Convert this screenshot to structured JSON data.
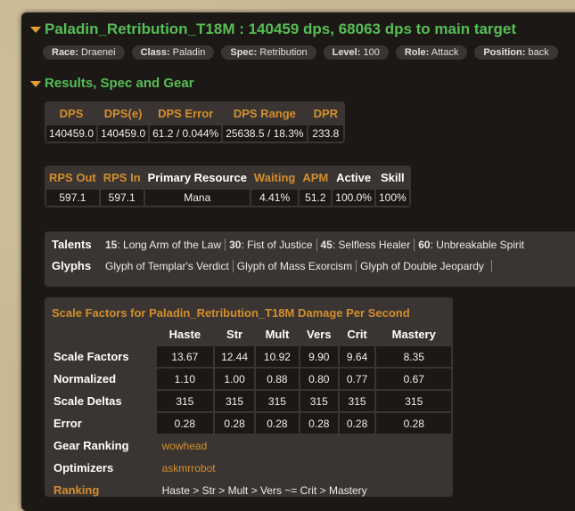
{
  "header": {
    "title": "Paladin_Retribution_T18M : 140459 dps, 68063 dps to main target",
    "tags": [
      {
        "key": "Race:",
        "value": "Draenei"
      },
      {
        "key": "Class:",
        "value": "Paladin"
      },
      {
        "key": "Spec:",
        "value": "Retribution"
      },
      {
        "key": "Level:",
        "value": "100"
      },
      {
        "key": "Role:",
        "value": "Attack"
      },
      {
        "key": "Position:",
        "value": "back"
      }
    ]
  },
  "section": {
    "title": "Results, Spec and Gear"
  },
  "dps_table": {
    "headers": [
      "DPS",
      "DPS(e)",
      "DPS Error",
      "DPS Range",
      "DPR"
    ],
    "values": [
      "140459.0",
      "140459.0",
      "61.2 / 0.044%",
      "25638.5 / 18.3%",
      "233.8"
    ]
  },
  "resource_table": {
    "headers": [
      "RPS Out",
      "RPS In",
      "Primary Resource",
      "Waiting",
      "APM",
      "Active",
      "Skill"
    ],
    "values": [
      "597.1",
      "597.1",
      "Mana",
      "4.41%",
      "51.2",
      "100.0%",
      "100%"
    ]
  },
  "talents": {
    "label": "Talents",
    "items": [
      {
        "tier": "15",
        "name": ": Long Arm of the Law"
      },
      {
        "tier": "30",
        "name": ": Fist of Justice"
      },
      {
        "tier": "45",
        "name": ": Selfless Healer"
      },
      {
        "tier": "60",
        "name": ": Unbreakable Spirit"
      }
    ]
  },
  "glyphs": {
    "label": "Glyphs",
    "items": [
      "Glyph of Templar's Verdict",
      "Glyph of Mass Exorcism",
      "Glyph of Double Jeopardy"
    ]
  },
  "scale_factors": {
    "title": "Scale Factors for Paladin_Retribution_T18M Damage Per Second",
    "columns": [
      "Haste",
      "Str",
      "Mult",
      "Vers",
      "Crit",
      "Mastery"
    ],
    "rows": [
      {
        "label": "Scale Factors",
        "values": [
          "13.67",
          "12.44",
          "10.92",
          "9.90",
          "9.64",
          "8.35"
        ]
      },
      {
        "label": "Normalized",
        "values": [
          "1.10",
          "1.00",
          "0.88",
          "0.80",
          "0.77",
          "0.67"
        ]
      },
      {
        "label": "Scale Deltas",
        "values": [
          "315",
          "315",
          "315",
          "315",
          "315",
          "315"
        ]
      },
      {
        "label": "Error",
        "values": [
          "0.28",
          "0.28",
          "0.28",
          "0.28",
          "0.28",
          "0.28"
        ]
      }
    ],
    "gear_ranking": {
      "label": "Gear Ranking",
      "link": "wowhead"
    },
    "optimizers": {
      "label": "Optimizers",
      "link": "askmrrobot"
    },
    "ranking": {
      "label": "Ranking",
      "value": "Haste > Str > Mult > Vers ~= Crit > Mastery"
    }
  },
  "colors": {
    "accent_green": "#56bd56",
    "accent_orange": "#d38e2e",
    "panel_bg": "#1c1815"
  }
}
